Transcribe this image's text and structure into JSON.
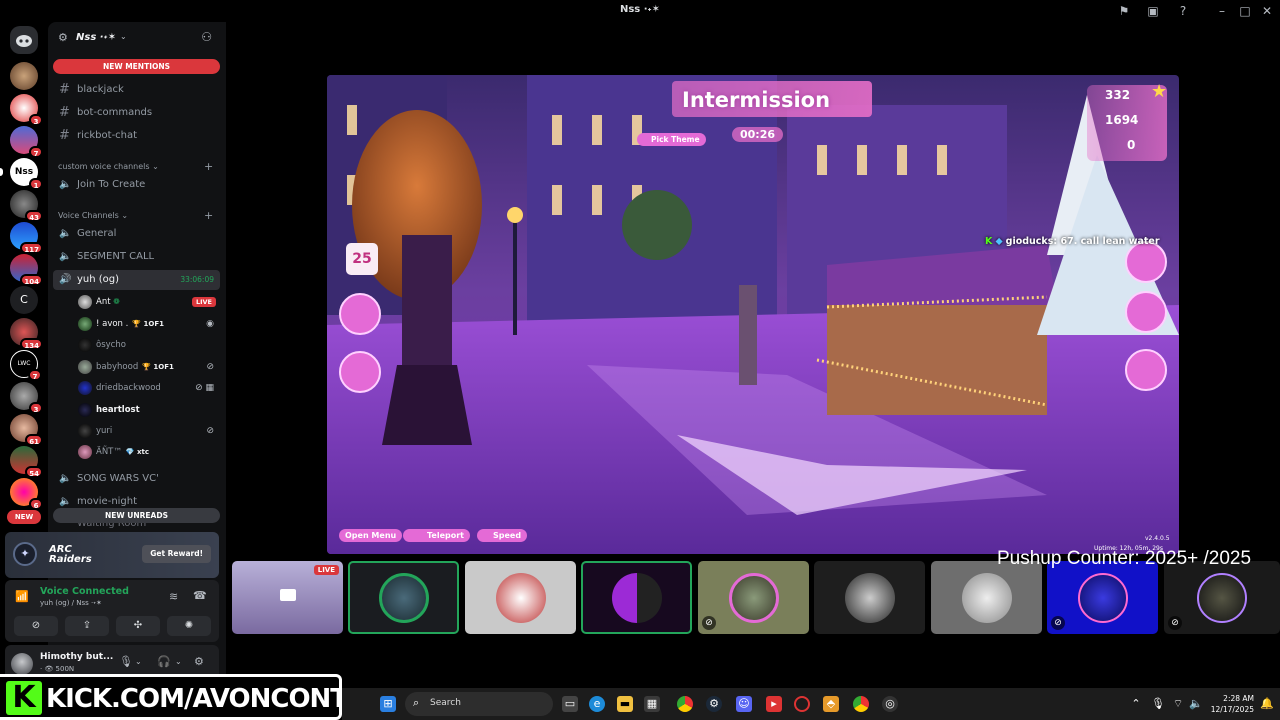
{
  "window": {
    "title": "Nss ·˖✶"
  },
  "rail": {
    "badges": [
      "",
      "3",
      "7",
      "1",
      "43",
      "117",
      "104",
      "",
      "134",
      "7",
      "3",
      "61",
      "54",
      "6"
    ],
    "new_label": "NEW"
  },
  "guild": {
    "name": "Nss ·˖✶"
  },
  "banners": {
    "new_mentions": "NEW MENTIONS",
    "new_unreads": "NEW UNREADS"
  },
  "channels": {
    "text": [
      "blackjack",
      "bot-commands",
      "rickbot-chat"
    ],
    "cat_custom": "custom voice channels",
    "join_to_create": "Join To Create",
    "cat_voice": "Voice Channels",
    "general": "General",
    "segment_call": "SEGMENT CALL",
    "active_voice": "yuh (og)",
    "active_time": "33:06:09",
    "song_wars": "SONG WARS VC'",
    "movie_night": "movie-night",
    "waiting_room": "Waiting Room"
  },
  "voice_users": [
    {
      "name": "Ant",
      "tag": "",
      "live": "LIVE"
    },
    {
      "name": "! avon .",
      "tag": "🏆 1OF1"
    },
    {
      "name": "ôsycho",
      "tag": ""
    },
    {
      "name": "babyhood",
      "tag": "🏆 1OF1"
    },
    {
      "name": "driedbackwood",
      "tag": ""
    },
    {
      "name": "heartlost",
      "tag": ""
    },
    {
      "name": "yuri",
      "tag": ""
    },
    {
      "name": "ÄÑT™",
      "tag": "💎 xtc"
    }
  ],
  "promo": {
    "brand": "ARC Raiders",
    "button": "Get Reward!"
  },
  "voice_panel": {
    "state": "Voice Connected",
    "sub": "yuh (og) / Nss ·˖✶"
  },
  "user": {
    "name": "Himothy but...",
    "status": "· 👁 500N"
  },
  "game": {
    "title": "Intermission",
    "timer": "00:26",
    "pick_theme": "Pick Theme",
    "currency_1": "332",
    "currency_2": "1694",
    "currency_3": "0",
    "day_badge": "25",
    "chat_user": "gioducks",
    "chat_msg": ": 67. call lean water",
    "btn_open_menu": "Open Menu",
    "btn_teleport": "Teleport",
    "btn_speed": "Speed",
    "version": "v2.4.0.5",
    "uptime": "Uptime: 12h, 05m, 29s"
  },
  "tiles": {
    "live_label": "LIVE"
  },
  "overlay": {
    "pushup": "Pushup Counter: 2025+ /2025",
    "kick_letter": "K",
    "kick_url": "KICK.COM/AVONCONTENT"
  },
  "taskbar": {
    "search_placeholder": "Search",
    "time": "2:28 AM",
    "date": "12/17/2025"
  },
  "colors": {
    "discord_green": "#23a55a",
    "discord_red": "#da373c",
    "kick_green": "#53fc18",
    "game_pink": "#e46ad6"
  }
}
